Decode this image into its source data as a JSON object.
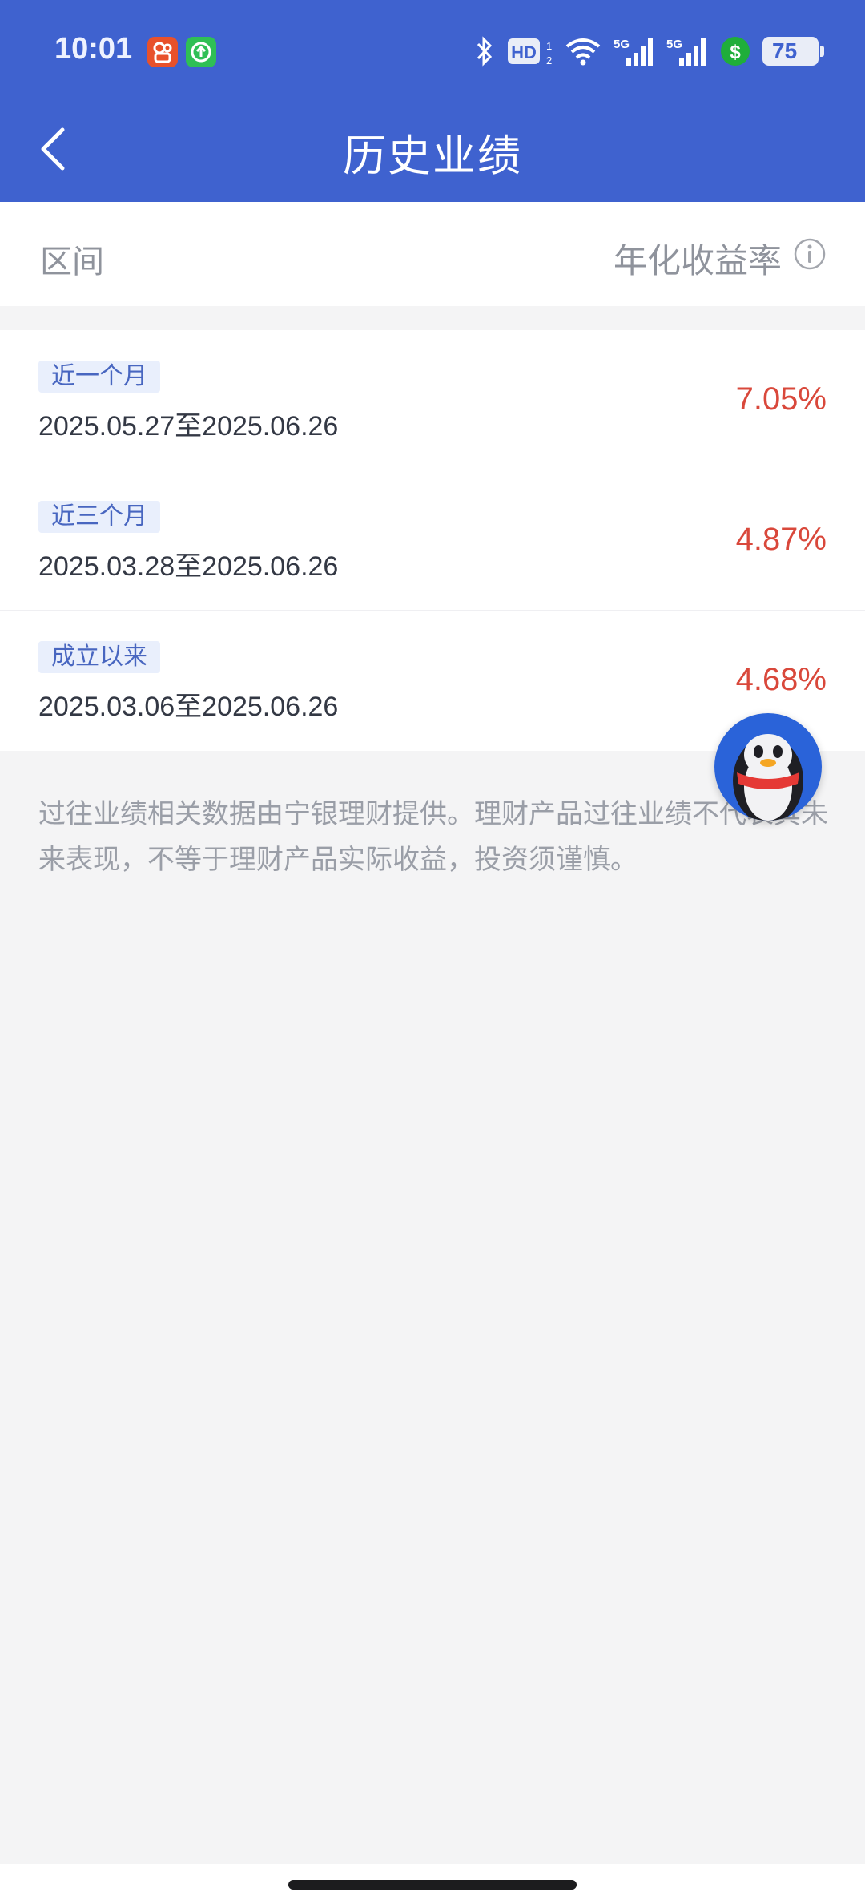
{
  "status_bar": {
    "time": "10:01",
    "battery": "75",
    "network": "5G",
    "hd_badge": "HD"
  },
  "header": {
    "title": "历史业绩"
  },
  "columns": {
    "left": "区间",
    "right": "年化收益率"
  },
  "rows": [
    {
      "tag": "近一个月",
      "range": "2025.05.27至2025.06.26",
      "rate": "7.05%"
    },
    {
      "tag": "近三个月",
      "range": "2025.03.28至2025.06.26",
      "rate": "4.87%"
    },
    {
      "tag": "成立以来",
      "range": "2025.03.06至2025.06.26",
      "rate": "4.68%"
    }
  ],
  "disclaimer": "过往业绩相关数据由宁银理财提供。理财产品过往业绩不代表其未来表现，不等于理财产品实际收益，投资须谨慎。",
  "colors": {
    "header_bg": "#3f62cf",
    "rate_red": "#d9483b",
    "tag_bg": "#e9effc",
    "tag_text": "#4866c0"
  }
}
